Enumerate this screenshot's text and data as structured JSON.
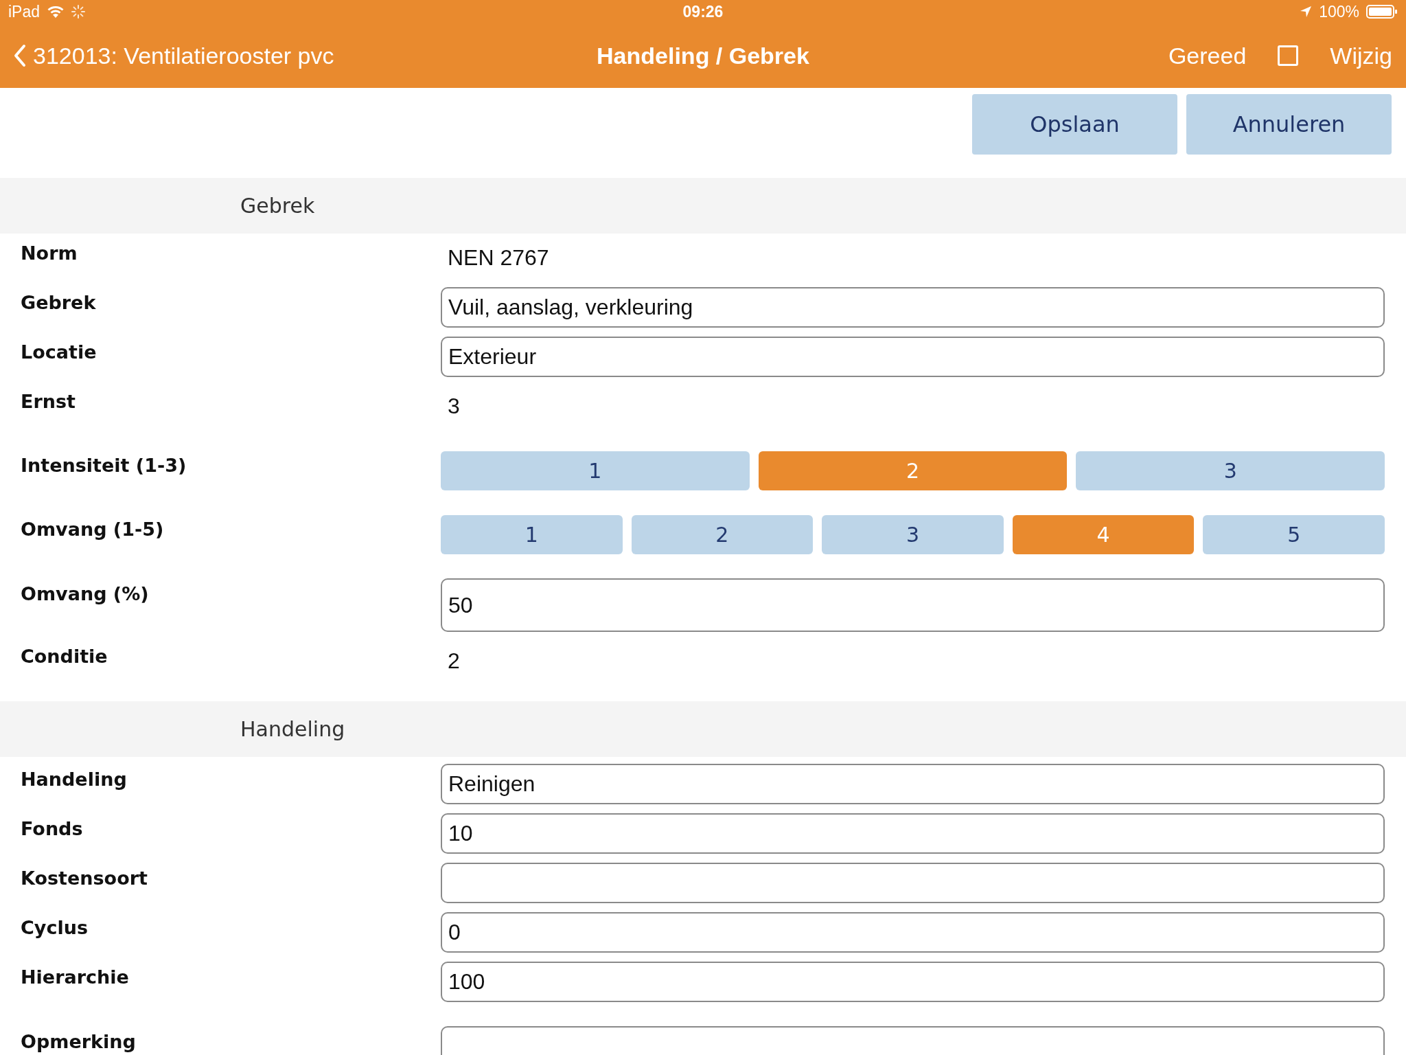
{
  "status_bar": {
    "device": "iPad",
    "time": "09:26",
    "battery": "100%"
  },
  "nav": {
    "back": "312013: Ventilatierooster pvc",
    "title": "Handeling / Gebrek",
    "done": "Gereed",
    "checkbox": {
      "checked": false
    },
    "edit": "Wijzig"
  },
  "actions": [
    "Opslaan",
    "Annuleren"
  ],
  "sections": [
    {
      "title": "Gebrek",
      "rows": [
        {
          "kind": "value",
          "label": "Norm",
          "value": "NEN 2767"
        },
        {
          "kind": "field",
          "label": "Gebrek",
          "value": "Vuil, aanslag, verkleuring"
        },
        {
          "kind": "field",
          "label": "Locatie",
          "value": "Exterieur"
        },
        {
          "kind": "value",
          "label": "Ernst",
          "value": "3"
        },
        {
          "kind": "segments",
          "label": "Intensiteit (1-3)",
          "options": [
            {
              "label": "1",
              "selected": false
            },
            {
              "label": "2",
              "selected": true
            },
            {
              "label": "3",
              "selected": false
            }
          ]
        },
        {
          "kind": "segments",
          "label": "Omvang (1-5)",
          "options": [
            {
              "label": "1",
              "selected": false
            },
            {
              "label": "2",
              "selected": false
            },
            {
              "label": "3",
              "selected": false
            },
            {
              "label": "4",
              "selected": true
            },
            {
              "label": "5",
              "selected": false
            }
          ]
        },
        {
          "kind": "textarea",
          "label": "Omvang (%)",
          "value": "50"
        },
        {
          "kind": "value",
          "label": "Conditie",
          "value": "2"
        }
      ]
    },
    {
      "title": "Handeling",
      "rows": [
        {
          "kind": "field",
          "label": "Handeling",
          "value": "Reinigen"
        },
        {
          "kind": "field",
          "label": "Fonds",
          "value": "10"
        },
        {
          "kind": "field",
          "label": "Kostensoort"
        },
        {
          "kind": "field",
          "label": "Cyclus",
          "value": "0"
        },
        {
          "kind": "field",
          "label": "Hierarchie",
          "value": "100"
        },
        {
          "kind": "textarea",
          "label": "Opmerking"
        }
      ]
    }
  ]
}
